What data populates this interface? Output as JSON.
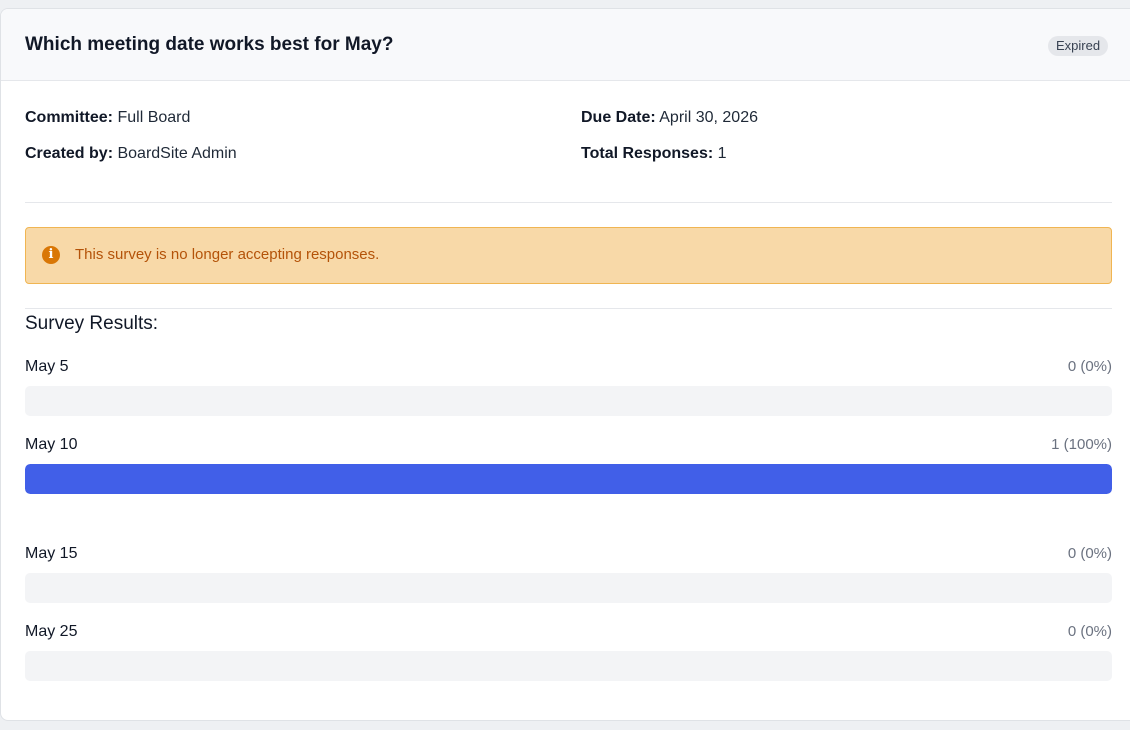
{
  "header": {
    "title": "Which meeting date works best for May?",
    "status": "Expired"
  },
  "meta": {
    "committee_label": "Committee:",
    "committee_value": "Full Board",
    "created_by_label": "Created by:",
    "created_by_value": "BoardSite Admin",
    "due_date_label": "Due Date:",
    "due_date_value": "April 30, 2026",
    "total_responses_label": "Total Responses:",
    "total_responses_value": "1"
  },
  "alert": {
    "icon": "info-icon",
    "message": "This survey is no longer accepting responses."
  },
  "results": {
    "title": "Survey Results:",
    "options": [
      {
        "label": "May 5",
        "count_text": "0 (0%)",
        "percent": 0
      },
      {
        "label": "May 10",
        "count_text": "1 (100%)",
        "percent": 100
      },
      {
        "label": "May 15",
        "count_text": "0 (0%)",
        "percent": 0
      },
      {
        "label": "May 25",
        "count_text": "0 (0%)",
        "percent": 0
      }
    ]
  },
  "colors": {
    "bar_fill": "#415fe8",
    "bar_track": "#f3f4f6",
    "alert_bg": "#f8d9a8",
    "alert_border": "#f0b552",
    "alert_text": "#b45309",
    "badge_bg": "#e5e7eb"
  }
}
